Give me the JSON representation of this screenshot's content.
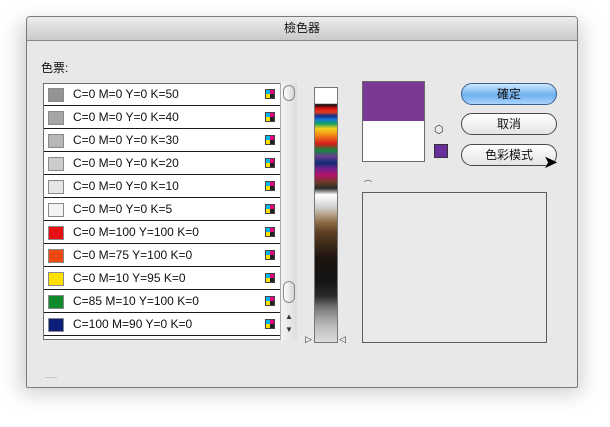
{
  "dialog": {
    "title": "檢色器"
  },
  "swatches": {
    "label": "色票:",
    "items": [
      {
        "label": "C=0 M=0 Y=0 K=50",
        "color": "#949494"
      },
      {
        "label": "C=0 M=0 Y=0 K=40",
        "color": "#a5a5a5"
      },
      {
        "label": "C=0 M=0 Y=0 K=30",
        "color": "#b8b8b8"
      },
      {
        "label": "C=0 M=0 Y=0 K=20",
        "color": "#cccccc"
      },
      {
        "label": "C=0 M=0 Y=0 K=10",
        "color": "#e6e6e6"
      },
      {
        "label": "C=0 M=0 Y=0 K=5",
        "color": "#f2f2f2"
      },
      {
        "label": "C=0 M=100 Y=100 K=0",
        "color": "#e50f14"
      },
      {
        "label": "C=0 M=75 Y=100 K=0",
        "color": "#ec4a12"
      },
      {
        "label": "C=0 M=10 Y=95 K=0",
        "color": "#ffe000"
      },
      {
        "label": "C=85 M=10 Y=100 K=0",
        "color": "#0f8a2c"
      },
      {
        "label": "C=100 M=90 Y=0 K=0",
        "color": "#0d1f7a"
      }
    ]
  },
  "preview": {
    "new_color": "#7b3996",
    "old_color": "#ffffff"
  },
  "websafe_color": "#6a2d9c",
  "buttons": {
    "ok": "確定",
    "cancel": "取消",
    "color_mode": "色彩模式"
  },
  "icons": {
    "cube": "cube-icon",
    "cursor": "pointer-cursor-icon",
    "cmyk": "cmyk-process-icon"
  }
}
